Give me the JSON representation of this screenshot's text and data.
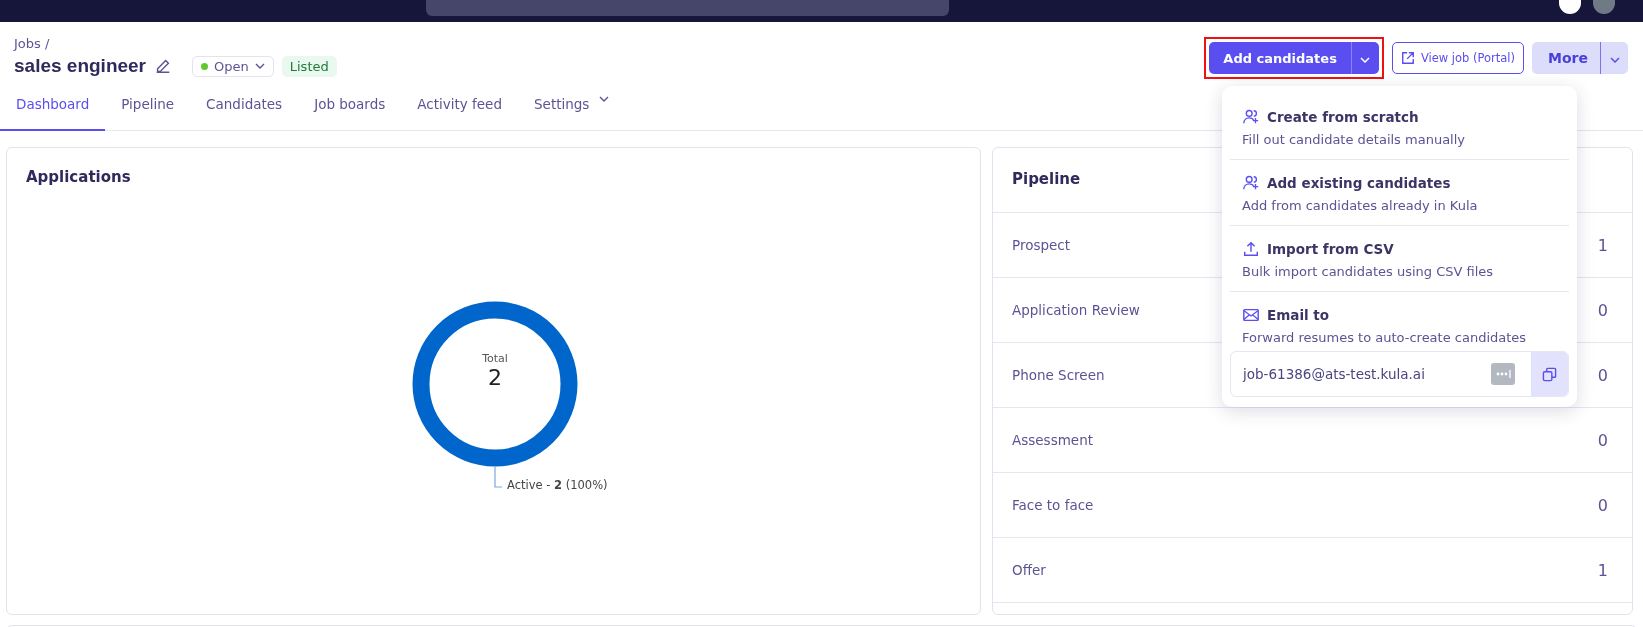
{
  "breadcrumb": "Jobs /",
  "job": {
    "title": "sales engineer",
    "status": {
      "label": "Open",
      "color": "#5fc82a"
    },
    "listing": "Listed"
  },
  "actions": {
    "primary": "Add candidates",
    "secondary": "View job (Portal)",
    "more": "More",
    "highlighted": true
  },
  "tabs": [
    {
      "label": "Dashboard",
      "selected": true,
      "menu": false
    },
    {
      "label": "Pipeline",
      "selected": false,
      "menu": false
    },
    {
      "label": "Candidates",
      "selected": false,
      "menu": false
    },
    {
      "label": "Job boards",
      "selected": false,
      "menu": false
    },
    {
      "label": "Activity feed",
      "selected": false,
      "menu": false
    },
    {
      "label": "Settings",
      "selected": false,
      "menu": true
    }
  ],
  "applications": {
    "title": "Applications",
    "center_label": "Total",
    "center_value": "2",
    "legend": "Active - **2** (100%)"
  },
  "pipeline": {
    "title": "Pipeline",
    "stages": [
      {
        "name": "Prospect",
        "count": "1"
      },
      {
        "name": "Application Review",
        "count": "0"
      },
      {
        "name": "Phone Screen",
        "count": "0"
      },
      {
        "name": "Assessment",
        "count": "0"
      },
      {
        "name": "Face to face",
        "count": "0"
      },
      {
        "name": "Offer",
        "count": "1"
      }
    ]
  },
  "add_menu": {
    "items": [
      {
        "kind": "person",
        "title": "Create from scratch",
        "description": "Fill out candidate details manually"
      },
      {
        "kind": "person",
        "title": "Add existing candidates",
        "description": "Add from candidates already in Kula"
      },
      {
        "kind": "upload",
        "title": "Import from CSV",
        "description": "Bulk import candidates using CSV files"
      },
      {
        "kind": "mail",
        "title": "Email to",
        "description": "Forward resumes to auto-create candidates"
      }
    ],
    "email": "job-61386@ats-test.kula.ai"
  }
}
